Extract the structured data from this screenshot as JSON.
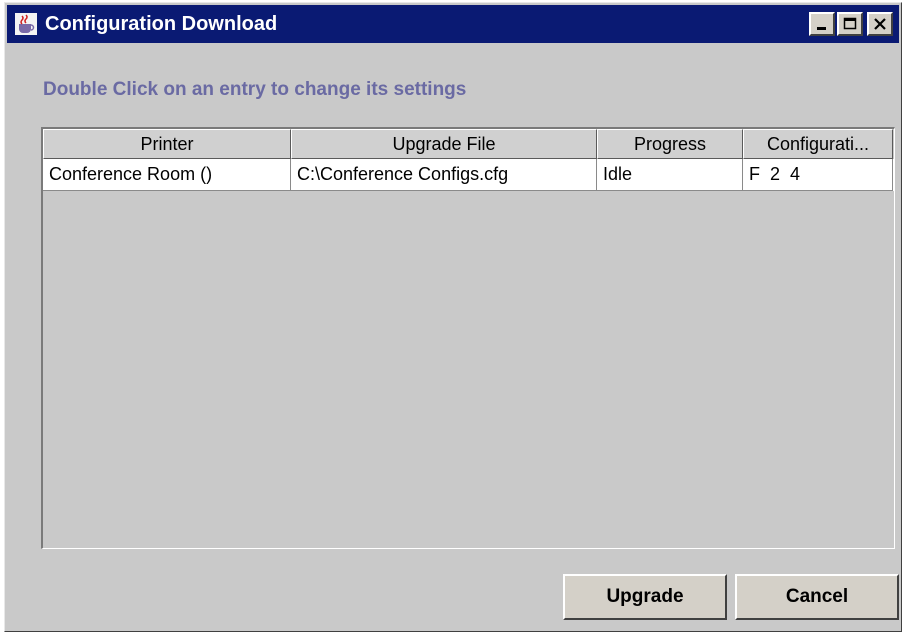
{
  "window": {
    "title": "Configuration Download",
    "icon": "java-coffee-cup-icon",
    "controls": [
      "minimize-icon",
      "maximize-icon",
      "close-icon"
    ],
    "title_bar_color": "#0a1a73"
  },
  "instruction": "Double Click on an entry to change its settings",
  "table": {
    "headers": [
      "Printer",
      "Upgrade File",
      "Progress",
      "Configurati..."
    ],
    "rows": [
      [
        "Conference Room ()",
        "C:\\Conference Configs.cfg",
        "Idle",
        "F  2  4"
      ]
    ]
  },
  "buttons": {
    "upgrade": "Upgrade",
    "cancel": "Cancel"
  }
}
